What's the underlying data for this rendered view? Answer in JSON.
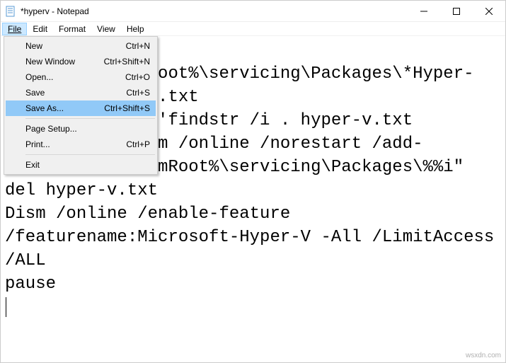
{
  "window": {
    "title": "*hyperv - Notepad"
  },
  "menubar": {
    "file": "File",
    "edit": "Edit",
    "format": "Format",
    "view": "View",
    "help": "Help"
  },
  "file_menu": {
    "new": {
      "label": "New",
      "shortcut": "Ctrl+N"
    },
    "new_window": {
      "label": "New Window",
      "shortcut": "Ctrl+Shift+N"
    },
    "open": {
      "label": "Open...",
      "shortcut": "Ctrl+O"
    },
    "save": {
      "label": "Save",
      "shortcut": "Ctrl+S"
    },
    "save_as": {
      "label": "Save As...",
      "shortcut": "Ctrl+Shift+S"
    },
    "page_setup": {
      "label": "Page Setup...",
      "shortcut": ""
    },
    "print": {
      "label": "Print...",
      "shortcut": "Ctrl+P"
    },
    "exit": {
      "label": "Exit",
      "shortcut": ""
    }
  },
  "editor": {
    "content": "pushd \"%~dp0\"\ndir /b %SystemRoot%\\servicing\\Packages\\*Hyper-V*.mum >hyper-v.txt\nfor /f %%i in ('findstr /i . hyper-v.txt 2^>nul') do dism /online /norestart /add-package:\"%SystemRoot%\\servicing\\Packages\\%%i\"\ndel hyper-v.txt\nDism /online /enable-feature /featurename:Microsoft-Hyper-V -All /LimitAccess /ALL\npause"
  },
  "watermark": "wsxdn.com"
}
